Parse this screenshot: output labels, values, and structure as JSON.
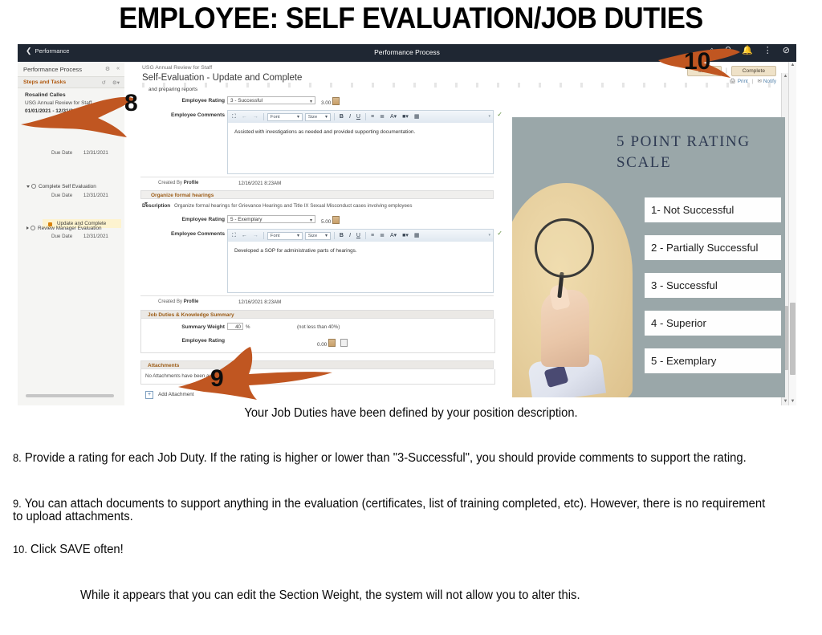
{
  "slide": {
    "title": "EMPLOYEE: SELF EVALUATION/JOB DUTIES",
    "caption": "Your Job Duties have been defined by your position description.",
    "bullets": [
      {
        "num": "8.",
        "text": "Provide a rating for each Job Duty.  If the rating is higher or lower than \"3-Successful\", you should provide comments to support the rating."
      },
      {
        "num": "9.",
        "text": "You can attach documents to support anything in the evaluation (certificates, list of training completed, etc).  However, there is no requirement to upload attachments."
      },
      {
        "num": "10.",
        "text": "Click SAVE often!"
      }
    ],
    "footnote": "While it appears that you can edit the Section Weight, the system will not allow you to alter this.",
    "annotations": [
      {
        "label": "8"
      },
      {
        "label": "9"
      },
      {
        "label": "10"
      }
    ],
    "annotation_color": "#c05621"
  },
  "app": {
    "topbar": {
      "back_label": "Performance",
      "title": "Performance Process",
      "icons": [
        "home-icon",
        "search-icon",
        "bell-icon",
        "kebab-menu-icon",
        "block-icon"
      ]
    },
    "sidebar": {
      "header": "Performance Process",
      "header_icons": [
        "gear-icon",
        "collapse-icon"
      ],
      "section_label": "Steps and Tasks",
      "section_icons": [
        "refresh-icon",
        "gear-dropdown-icon"
      ],
      "employee_name": "Rosalind Calles",
      "review_name": "USG Annual Review for Staff",
      "period": "01/01/2021  -  12/31/2021",
      "nodes": [
        {
          "label": "",
          "due_label": "Due Date",
          "due_date": "12/31/2021",
          "expanded": true
        },
        {
          "label": "Complete Self Evaluation",
          "due_label": "Due Date",
          "due_date": "12/31/2021",
          "expanded": true
        },
        {
          "label": "Review Manager Evaluation",
          "due_label": "Due Date",
          "due_date": "12/31/2021",
          "expanded": false
        }
      ],
      "selected_task": "Update and Complete"
    },
    "main": {
      "breadcrumb": "USG Annual Review for Staff",
      "page_title": "Self-Evaluation - Update and Complete",
      "partial_text": "and preparing reports",
      "save_label": "Save",
      "complete_label": "Complete",
      "print_label": "Print",
      "notify_label": "Notify",
      "sections": [
        {
          "rating_label": "Employee Rating",
          "rating_value": "3 - Successful",
          "rating_number": "3.00",
          "comments_label": "Employee Comments",
          "comments_text": "Assisted with investigations as needed and provided supporting documentation.",
          "created_by_label": "Created By",
          "created_by": "Profile",
          "created_date": "12/16/2021  8:23AM"
        },
        {
          "group_title": "Organize formal hearings",
          "description_label": "Description",
          "description": "Organize formal hearings for Grievance Hearings and Title IX Sexual Misconduct cases involving employees",
          "rating_label": "Employee Rating",
          "rating_value": "5 - Exemplary",
          "rating_number": "5.00",
          "comments_label": "Employee Comments",
          "comments_text": "Developed a SOP for administrative parts of hearings.",
          "created_by_label": "Created By",
          "created_by": "Profile",
          "created_date": "12/16/2021  8:23AM"
        }
      ],
      "summary": {
        "title": "Job Duties & Knowledge Summary",
        "weight_label": "Summary Weight",
        "weight_value": "40",
        "weight_unit": "%",
        "weight_note": "(not less than 40%)",
        "rating_label": "Employee Rating",
        "rating_number": "0.00"
      },
      "attachments": {
        "title": "Attachments",
        "empty_text": "No Attachments have been added.",
        "add_label": "Add Attachment"
      },
      "editor_toolbar": {
        "maximize": "maximize-icon",
        "undo": "undo-icon",
        "redo": "redo-icon",
        "font_label": "Font",
        "size_label": "Size",
        "bold": "B",
        "italic": "I",
        "underline": "U",
        "numbered_list": "numbered-list-icon",
        "bullet_list": "bullet-list-icon",
        "text_color": "A",
        "bg_color": "A",
        "table": "table-icon"
      }
    }
  },
  "rating_scale_image": {
    "title": "5 POINT RATING SCALE",
    "items": [
      "1- Not Successful",
      "2 - Partially Successful",
      "3 - Successful",
      "4 - Superior",
      "5 - Exemplary"
    ],
    "background_color": "#9aa7a9",
    "title_color": "#2e3a52"
  }
}
